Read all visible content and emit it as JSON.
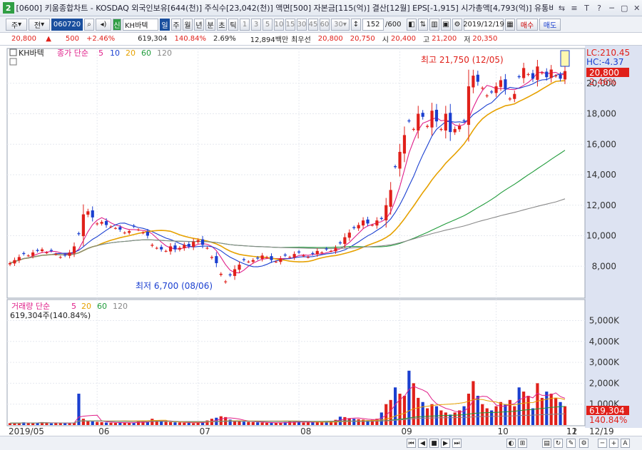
{
  "window": {
    "num": "2",
    "title": "[0600] 키움종합차트 - KOSDAQ 외국인보유[644(천)] 주식수[23,042(천)] 액면[500] 자본금[115(억)] 결산[12월] EPS[-1,915] 시가총액[4,793(억)] 유통비율[70",
    "controls": [
      "⇆",
      "≡",
      "T",
      "?",
      "─",
      "▢",
      "✕"
    ]
  },
  "toolbar": {
    "type1": "주",
    "type2": "전",
    "code": "060720",
    "stock_name": "KH바텍",
    "period_buttons": [
      "일",
      "주",
      "월",
      "년",
      "분",
      "초",
      "틱"
    ],
    "minute_buttons": [
      "1",
      "3",
      "5",
      "10",
      "15",
      "30",
      "45",
      "60",
      "30"
    ],
    "count": "152",
    "count_total": "/600",
    "date": "2019/12/19",
    "buy": "매수",
    "sell": "매도"
  },
  "pricebar": {
    "price": "20,800",
    "arrow": "▲",
    "change": "500",
    "pct": "+2.46%",
    "volume": "619,304",
    "vol_ratio": "140.84%",
    "turnover": "2.69%",
    "amount": "12,894백만",
    "bid_label": "최우선",
    "bid1": "20,800",
    "bid2": "20,750",
    "open_label": "시",
    "open": "20,400",
    "high_label": "고",
    "high": "21,200",
    "low_label": "저",
    "low": "20,350"
  },
  "chart_legend": {
    "name": "KH바텍",
    "ma_title": "종가 단순",
    "ma_periods": [
      "5",
      "10",
      "20",
      "60",
      "120"
    ],
    "ma_colors": [
      "#e0208a",
      "#1a3fd0",
      "#e6a100",
      "#1f9b3a",
      "#888888"
    ]
  },
  "volume_legend": {
    "title": "거래량 단순",
    "periods": [
      "5",
      "20",
      "60",
      "120"
    ],
    "summary": "619,304주(140.84%)"
  },
  "annotations": {
    "high": "최고 21,750 (12/05)",
    "low": "최저 6,700 (08/06)"
  },
  "right_labels": {
    "lc": "LC:210.45",
    "hc": "HC:-4.37",
    "price_tag": "20,800",
    "pct_tag": "2.46%",
    "vol_tag": "619,304",
    "vol_pct_tag": "140.84%"
  },
  "price_axis": [
    "20,000",
    "18,000",
    "16,000",
    "14,000",
    "12,000",
    "10,000",
    "8,000"
  ],
  "volume_axis": [
    "5,000K",
    "4,000K",
    "3,000K",
    "2,000K",
    "1,000K"
  ],
  "x_axis": [
    "2019/05",
    "06",
    "07",
    "08",
    "09",
    "10",
    "11",
    "12",
    "12/19"
  ],
  "colors": {
    "up": "#e0201a",
    "down": "#1a3fd0"
  },
  "chart_data": {
    "type": "candlestick",
    "ylim": [
      6000,
      22000
    ],
    "volume_ylim": [
      0,
      5800
    ],
    "note": "daily candles 2019/05-2019/12; closes approx",
    "closes": [
      8200,
      8400,
      8600,
      8800,
      8700,
      8900,
      9000,
      9100,
      8900,
      9000,
      8800,
      8600,
      8700,
      8900,
      9300,
      10100,
      11400,
      11600,
      11200,
      10800,
      10900,
      10700,
      10600,
      10500,
      10400,
      10200,
      10300,
      10600,
      10400,
      10200,
      10000,
      9400,
      9200,
      9100,
      9000,
      9300,
      9100,
      9200,
      9400,
      9300,
      9600,
      9700,
      9400,
      9200,
      8600,
      8200,
      7500,
      7000,
      7400,
      7800,
      8100,
      8400,
      8300,
      8400,
      8500,
      8700,
      8600,
      8400,
      8300,
      8500,
      8700,
      8600,
      8800,
      8900,
      8700,
      8600,
      8800,
      9000,
      8900,
      9100,
      9000,
      9200,
      9500,
      9900,
      10200,
      10500,
      10700,
      11000,
      10800,
      10700,
      11000,
      11100,
      12000,
      13000,
      14500,
      15500,
      16600,
      17500,
      17000,
      18000,
      17800,
      17200,
      18200,
      17500,
      17000,
      18000,
      16800,
      17000,
      17200,
      17500,
      19800,
      20500,
      20100,
      19700,
      19200,
      19400,
      19800,
      20200,
      19600,
      19000,
      19300,
      20400,
      21000,
      20600,
      20300,
      21100,
      20700,
      20400,
      20900,
      20500,
      20300,
      20800
    ],
    "volume": [
      90,
      110,
      80,
      130,
      100,
      90,
      120,
      140,
      100,
      80,
      90,
      110,
      100,
      90,
      120,
      1500,
      300,
      200,
      180,
      150,
      140,
      120,
      110,
      100,
      130,
      120,
      110,
      100,
      180,
      160,
      150,
      300,
      200,
      180,
      150,
      140,
      130,
      120,
      110,
      100,
      90,
      130,
      150,
      220,
      300,
      350,
      420,
      380,
      260,
      200,
      180,
      160,
      150,
      140,
      130,
      120,
      110,
      100,
      100,
      120,
      140,
      160,
      150,
      140,
      120,
      130,
      150,
      170,
      160,
      180,
      200,
      250,
      400,
      380,
      330,
      300,
      280,
      260,
      230,
      250,
      300,
      600,
      1000,
      1200,
      1800,
      1500,
      1400,
      2600,
      2000,
      1300,
      1100,
      800,
      1000,
      900,
      700,
      600,
      500,
      600,
      700,
      900,
      1500,
      2100,
      1400,
      1000,
      800,
      700,
      900,
      1100,
      1000,
      1200,
      900,
      1800,
      1600,
      1400,
      800,
      2000,
      1300,
      1600,
      1500,
      1300,
      1100,
      900
    ]
  }
}
